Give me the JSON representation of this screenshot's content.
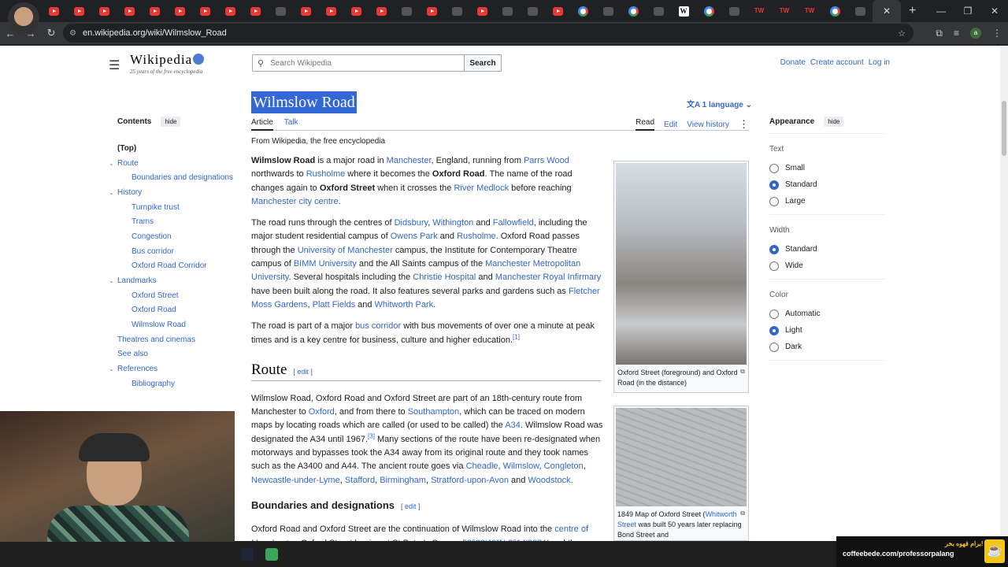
{
  "browser": {
    "tabs": [
      {
        "icon": "youtube-icon"
      },
      {
        "icon": "youtube-icon"
      },
      {
        "icon": "youtube-icon"
      },
      {
        "icon": "youtube-icon"
      },
      {
        "icon": "youtube-icon"
      },
      {
        "icon": "youtube-icon"
      },
      {
        "icon": "youtube-icon"
      },
      {
        "icon": "youtube-icon"
      },
      {
        "icon": "youtube-icon"
      },
      {
        "icon": "dark-icon"
      },
      {
        "icon": "youtube-icon"
      },
      {
        "icon": "youtube-icon"
      },
      {
        "icon": "youtube-icon"
      },
      {
        "icon": "youtube-icon"
      },
      {
        "icon": "dark-icon"
      },
      {
        "icon": "youtube-icon"
      },
      {
        "icon": "dark-icon"
      },
      {
        "icon": "youtube-icon"
      },
      {
        "icon": "dark-icon"
      },
      {
        "icon": "dark-icon"
      },
      {
        "icon": "youtube-icon"
      },
      {
        "icon": "google-icon"
      },
      {
        "icon": "dark-icon"
      },
      {
        "icon": "google-icon"
      },
      {
        "icon": "dark-icon"
      },
      {
        "icon": "wikipedia-icon"
      },
      {
        "icon": "google-icon"
      },
      {
        "icon": "dark-icon"
      },
      {
        "icon": "tw-icon",
        "text": "TW"
      },
      {
        "icon": "tw-icon",
        "text": "TW"
      },
      {
        "icon": "tw-icon",
        "text": "TW"
      },
      {
        "icon": "google-icon"
      },
      {
        "icon": "dark-icon"
      }
    ],
    "active_tab_close": "✕",
    "new_tab": "+",
    "window_controls": {
      "minimize": "—",
      "restore": "❐",
      "close": "✕"
    },
    "url": "en.wikipedia.org/wiki/Wilmslow_Road",
    "profile_initial": "a"
  },
  "wiki": {
    "logo_text": "Wikipedia",
    "logo_tagline": "25 years of the free encyclopedia",
    "search_placeholder": "Search Wikipedia",
    "search_button": "Search",
    "user_links": [
      "Donate",
      "Create account",
      "Log in"
    ],
    "toc": {
      "title": "Contents",
      "hide": "hide",
      "items": [
        {
          "label": "(Top)",
          "level": 0
        },
        {
          "label": "Route",
          "level": 1,
          "toggle": true
        },
        {
          "label": "Boundaries and designations",
          "level": 2
        },
        {
          "label": "History",
          "level": 1,
          "toggle": true
        },
        {
          "label": "Turnpike trust",
          "level": 2
        },
        {
          "label": "Trams",
          "level": 2
        },
        {
          "label": "Congestion",
          "level": 2
        },
        {
          "label": "Bus corridor",
          "level": 2
        },
        {
          "label": "Oxford Road Corridor",
          "level": 2
        },
        {
          "label": "Landmarks",
          "level": 1,
          "toggle": true
        },
        {
          "label": "Oxford Street",
          "level": 2
        },
        {
          "label": "Oxford Road",
          "level": 2
        },
        {
          "label": "Wilmslow Road",
          "level": 2
        },
        {
          "label": "Theatres and cinemas",
          "level": 1
        },
        {
          "label": "See also",
          "level": 1
        },
        {
          "label": "References",
          "level": 1,
          "toggle": true
        },
        {
          "label": "Bibliography",
          "level": 2
        }
      ]
    },
    "title": "Wilmslow Road",
    "languages": "1 language",
    "tabs_left": [
      "Article",
      "Talk"
    ],
    "tabs_right": [
      "Read",
      "Edit",
      "View history"
    ],
    "from": "From Wikipedia, the free encyclopedia",
    "figures": [
      {
        "caption": "Oxford Street (foreground) and Oxford Road (in the distance)"
      },
      {
        "caption_prefix": "1849 Map of Oxford Street (",
        "caption_link": "Whitworth Street",
        "caption_suffix": " was built 50 years later replacing Bond Street and"
      }
    ],
    "appearance": {
      "title": "Appearance",
      "hide": "hide",
      "groups": [
        {
          "label": "Text",
          "options": [
            "Small",
            "Standard",
            "Large"
          ],
          "selected": "Standard"
        },
        {
          "label": "Width",
          "options": [
            "Standard",
            "Wide"
          ],
          "selected": "Standard"
        },
        {
          "label": "Color",
          "options": [
            "Automatic",
            "Light",
            "Dark"
          ],
          "selected": "Light"
        }
      ]
    },
    "section_route": "Route",
    "section_boundaries": "Boundaries and designations",
    "edit_label": "[ edit ]"
  },
  "overlay": {
    "coffee_text_fa": "برام قهوه بخر!",
    "coffee_url": "coffeebede.com/professorpalang"
  },
  "colors": {
    "link": "#3366cc",
    "selection": "#3367d6",
    "chrome_bg": "#202124"
  }
}
